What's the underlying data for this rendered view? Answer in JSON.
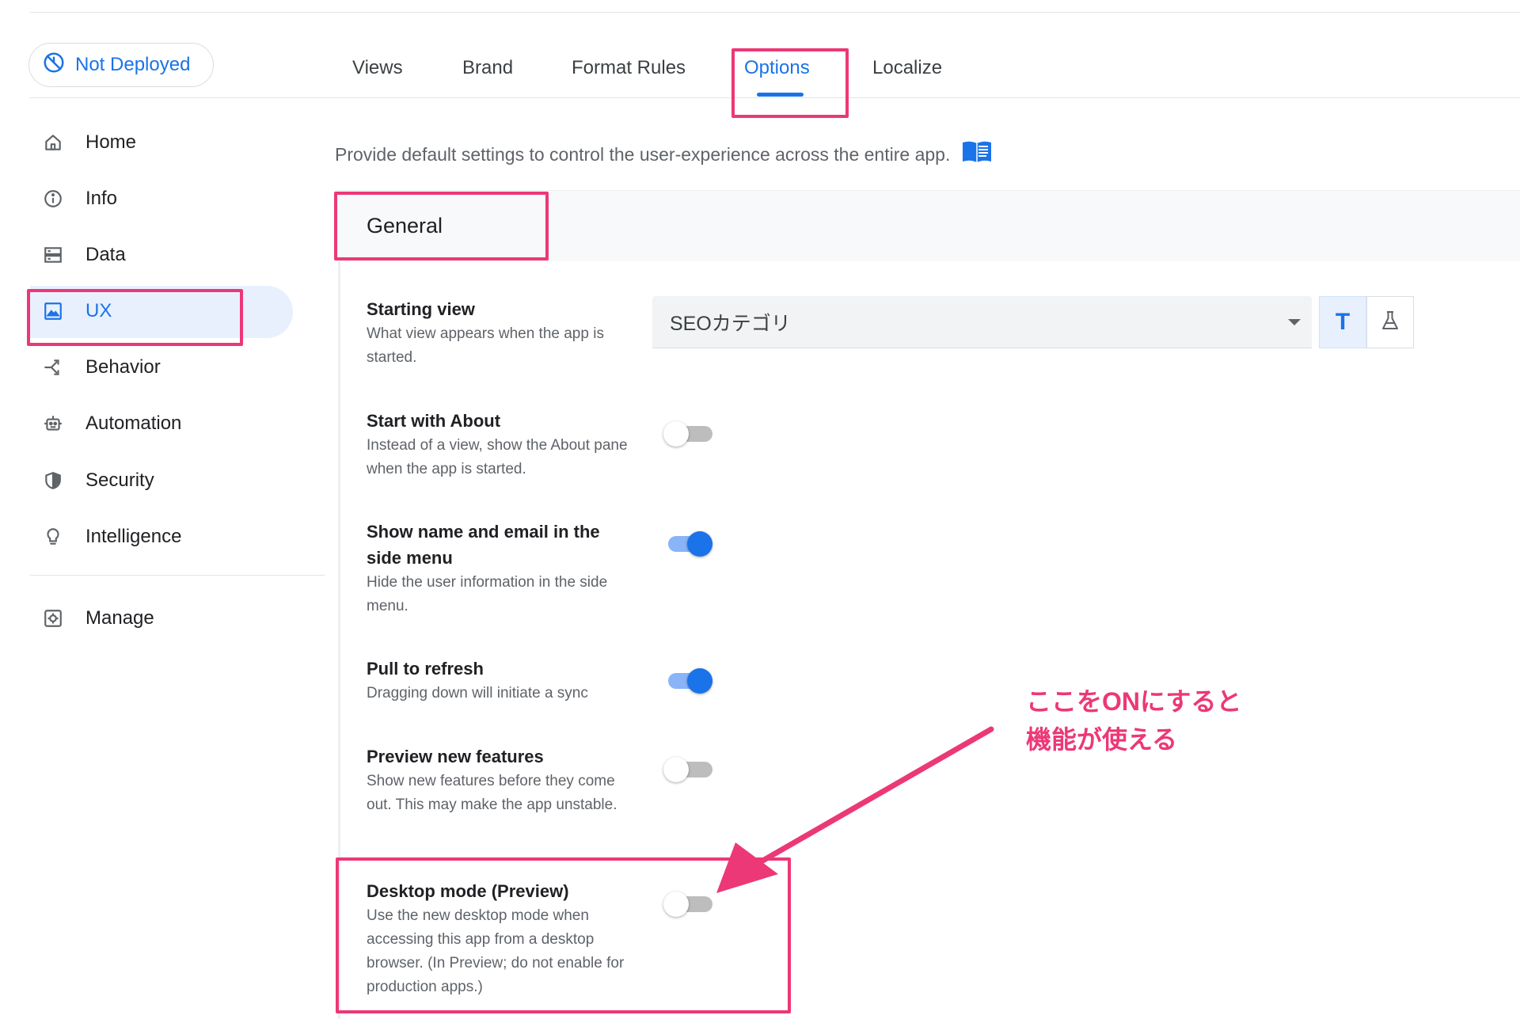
{
  "deploy_status": {
    "label": "Not Deployed",
    "icon": "not-deployed-icon"
  },
  "tabs": [
    {
      "label": "Views"
    },
    {
      "label": "Brand"
    },
    {
      "label": "Format Rules"
    },
    {
      "label": "Options",
      "active": true
    },
    {
      "label": "Localize"
    }
  ],
  "sidebar": {
    "items": [
      {
        "label": "Home",
        "icon": "home-icon"
      },
      {
        "label": "Info",
        "icon": "info-icon"
      },
      {
        "label": "Data",
        "icon": "data-icon"
      },
      {
        "label": "UX",
        "icon": "ux-icon",
        "active": true
      },
      {
        "label": "Behavior",
        "icon": "behavior-icon"
      },
      {
        "label": "Automation",
        "icon": "automation-icon"
      },
      {
        "label": "Security",
        "icon": "security-icon"
      },
      {
        "label": "Intelligence",
        "icon": "intelligence-icon"
      },
      {
        "label": "Manage",
        "icon": "manage-icon"
      }
    ]
  },
  "page": {
    "description": "Provide default settings to control the user-experience across the entire app.",
    "section_title": "General"
  },
  "settings": {
    "starting_view": {
      "title": "Starting view",
      "description": "What view appears when the app is started.",
      "value": "SEOカテゴリ",
      "text_mode_label": "T"
    },
    "start_with_about": {
      "title": "Start with About",
      "description": "Instead of a view, show the About pane when the app is started.",
      "enabled": false
    },
    "show_name_email": {
      "title": "Show name and email in the side menu",
      "description": "Hide the user information in the side menu.",
      "enabled": true
    },
    "pull_to_refresh": {
      "title": "Pull to refresh",
      "description": "Dragging down will initiate a sync",
      "enabled": true
    },
    "preview_new_features": {
      "title": "Preview new features",
      "description": "Show new features before they come out. This may make the app unstable.",
      "enabled": false
    },
    "desktop_mode": {
      "title": "Desktop mode (Preview)",
      "description": "Use the new desktop mode when accessing this app from a desktop browser. (In Preview; do not enable for production apps.)",
      "enabled": false
    }
  },
  "annotation": {
    "line1": "ここをONにすると",
    "line2": "機能が使える",
    "color": "#ec3877"
  },
  "colors": {
    "accent": "#1a73e8",
    "nav_active_bg": "#e8f0fe",
    "highlight": "#ec3877"
  }
}
